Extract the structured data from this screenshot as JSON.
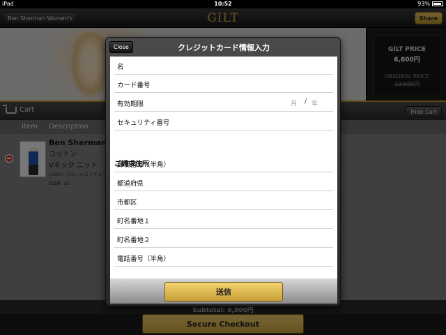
{
  "status_bar": {
    "device": "iPad",
    "time": "10:52",
    "battery": "93%"
  },
  "nav": {
    "back_label": "Ben Sherman Women's",
    "brand": "GILT",
    "share_label": "Share"
  },
  "hero": {
    "gilt_price_label": "GILT PRICE",
    "gilt_price": "6,800円",
    "original_price_label": "ORIGINAL PRICE",
    "original_price": "13,600円"
  },
  "cart": {
    "title": "Cart",
    "hide_label": "Hide Cart",
    "columns": [
      "Item",
      "Description"
    ],
    "item": {
      "brand": "Ben Sherman",
      "material": "コットン",
      "type": "Vネック ニット",
      "color": "Color: ブルー×ロイヤルブ",
      "size": "Size: xs"
    }
  },
  "subtotal": "Subtotal: 6,800円",
  "checkout_label": "Secure Checkout",
  "modal": {
    "close_label": "Close",
    "title": "クレジットカード情報入力",
    "fields": [
      {
        "label": "名"
      },
      {
        "label": "カード番号"
      },
      {
        "label": "有効期限",
        "month": "月",
        "separator": "/",
        "year": "年"
      },
      {
        "label": "セキュリティ番号"
      }
    ],
    "billing_heading": "ご請求住所",
    "address_fields": [
      {
        "label": "郵便番号（半角）"
      },
      {
        "label": "都道府県"
      },
      {
        "label": "市都区"
      },
      {
        "label": "町名番地１"
      },
      {
        "label": "町名番地２"
      },
      {
        "label": "電話番号（半角）"
      }
    ],
    "submit_label": "送信"
  },
  "colors": {
    "gold": "#c8a848",
    "danger": "#c9302c"
  }
}
